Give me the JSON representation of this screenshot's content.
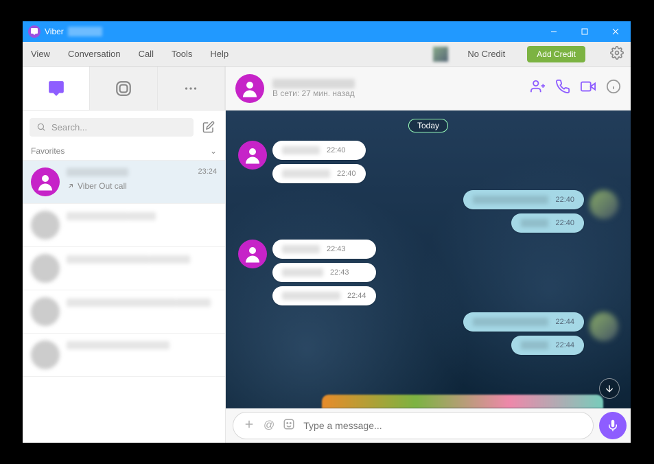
{
  "titlebar": {
    "app": "Viber"
  },
  "menu": {
    "view": "View",
    "conversation": "Conversation",
    "call": "Call",
    "tools": "Tools",
    "help": "Help",
    "nocredit": "No Credit",
    "addcredit": "Add Credit"
  },
  "search": {
    "placeholder": "Search..."
  },
  "favorites": {
    "label": "Favorites"
  },
  "conversations": [
    {
      "time": "23:24",
      "sub_icon": "call-arrow",
      "sub": "Viber Out call",
      "selected": true,
      "avatar": "purple"
    },
    {
      "time": "",
      "avatar": "blur"
    },
    {
      "time": "",
      "avatar": "blur"
    },
    {
      "time": "",
      "avatar": "blur"
    },
    {
      "time": "",
      "avatar": "blur"
    }
  ],
  "chat": {
    "status": "В сети: 27 мин. назад",
    "day": "Today",
    "messages": [
      {
        "dir": "in",
        "avatar": true,
        "bubbles": [
          {
            "time": "22:40"
          },
          {
            "time": "22:40"
          }
        ]
      },
      {
        "dir": "out",
        "avatar": true,
        "bubbles": [
          {
            "time": "22:40"
          },
          {
            "time": "22:40"
          }
        ]
      },
      {
        "dir": "in",
        "avatar": true,
        "bubbles": [
          {
            "time": "22:43"
          },
          {
            "time": "22:43"
          },
          {
            "time": "22:44"
          }
        ]
      },
      {
        "dir": "out",
        "avatar": true,
        "bubbles": [
          {
            "time": "22:44"
          },
          {
            "time": "22:44"
          }
        ]
      }
    ]
  },
  "input": {
    "placeholder": "Type a message..."
  }
}
